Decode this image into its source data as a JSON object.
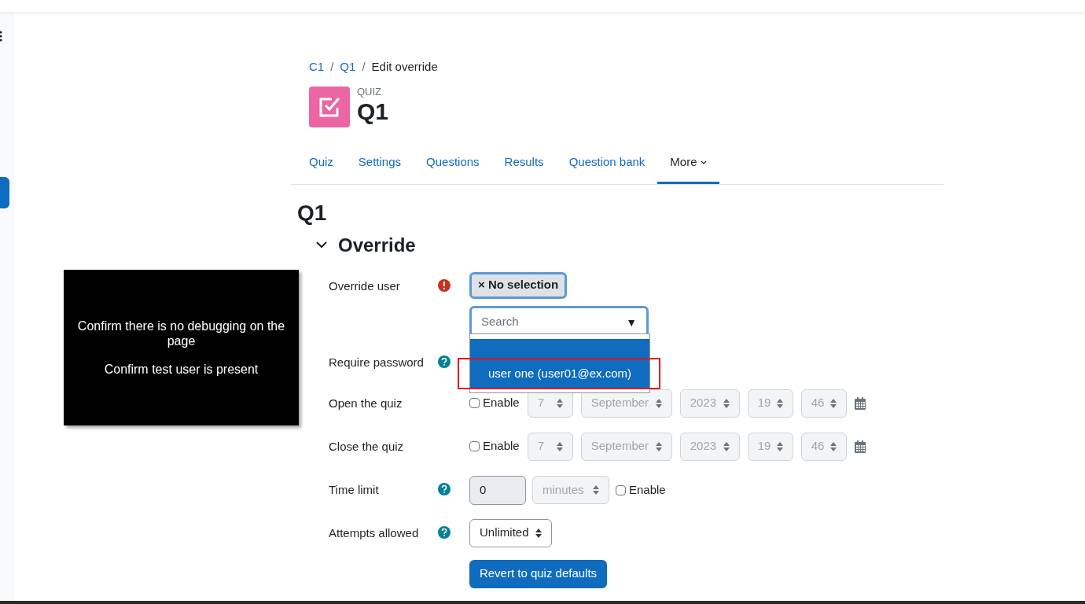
{
  "breadcrumb": [
    {
      "label": "C1",
      "link": true
    },
    {
      "separator": "/",
      "label": "Q1",
      "link": true
    },
    {
      "separator": "/",
      "label": "Edit override",
      "link": false
    }
  ],
  "activity": {
    "type": "QUIZ",
    "title": "Q1"
  },
  "tabs": [
    {
      "label": "Quiz",
      "selected": false
    },
    {
      "label": "Settings",
      "selected": false
    },
    {
      "label": "Questions",
      "selected": false
    },
    {
      "label": "Results",
      "selected": false
    },
    {
      "label": "Question bank",
      "selected": false
    },
    {
      "label": "More",
      "selected": true,
      "menu": true
    }
  ],
  "page_heading": "Q1",
  "section": {
    "title": "Override",
    "expanded": true
  },
  "rows": [
    {
      "kind": "autocomplete",
      "label": "Override user",
      "required": true,
      "chip": "× No selection",
      "placeholder": "Search",
      "arrow": "▼",
      "options": [
        {
          "label": "user one (user01@ex.com)",
          "selected": true,
          "highlighted_box": true
        }
      ]
    },
    {
      "kind": "empty",
      "label": "Require password",
      "help": true
    },
    {
      "kind": "date",
      "label": "Open the quiz",
      "checkbox_label": "Enable",
      "checked": false,
      "fields": [
        "7",
        "September",
        "2023",
        "19",
        "46"
      ]
    },
    {
      "kind": "date",
      "label": "Close the quiz",
      "checkbox_label": "Enable",
      "checked": false,
      "fields": [
        "7",
        "September",
        "2023",
        "19",
        "46"
      ]
    },
    {
      "kind": "duration",
      "label": "Time limit",
      "help": true,
      "value": "0",
      "unit": "minutes",
      "checkbox_label": "Enable",
      "checked": false
    },
    {
      "kind": "select",
      "label": "Attempts allowed",
      "help": true,
      "value": "Unlimited"
    }
  ],
  "button": "Revert to quiz defaults",
  "overlay": {
    "lines": [
      "Confirm there is no debugging on the page",
      "Confirm test user is present"
    ]
  }
}
